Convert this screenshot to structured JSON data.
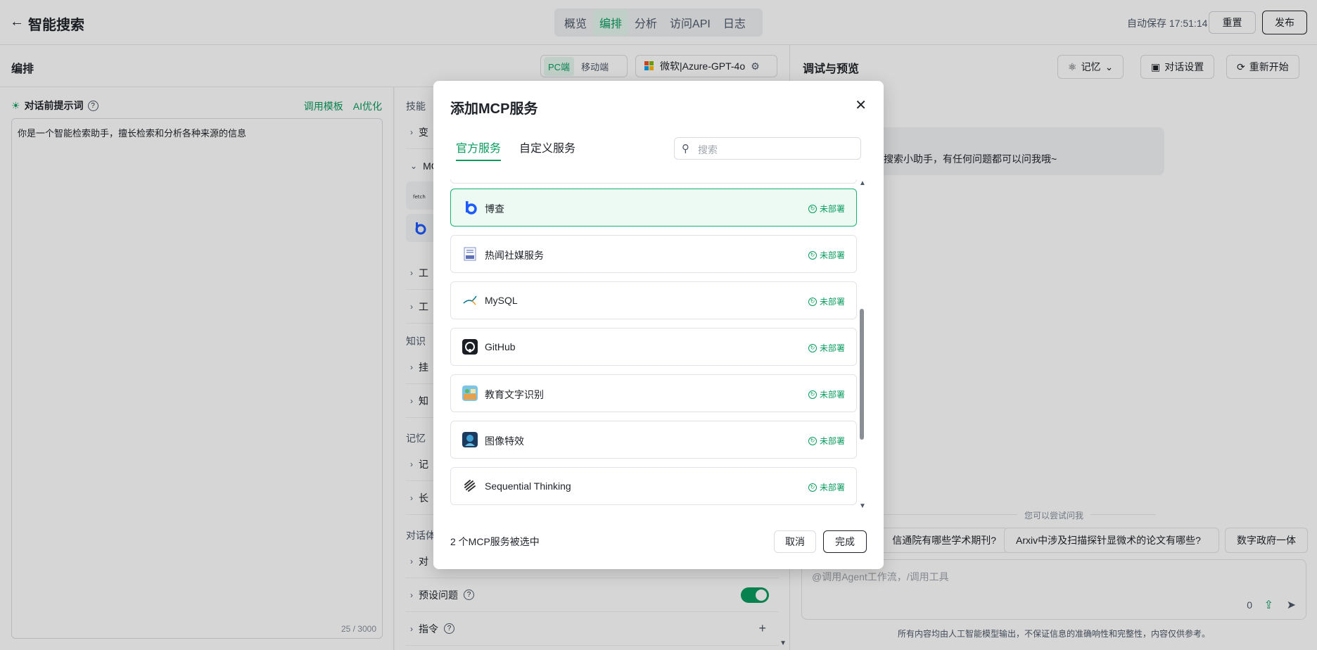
{
  "header": {
    "back_icon": "arrow-left-icon",
    "title": "智能搜索",
    "tabs": [
      {
        "label": "概览",
        "active": false
      },
      {
        "label": "编排",
        "active": true
      },
      {
        "label": "分析",
        "active": false
      },
      {
        "label": "访问API",
        "active": false
      },
      {
        "label": "日志",
        "active": false
      }
    ],
    "autosave": "自动保存 17:51:14",
    "reset_label": "重置",
    "publish_label": "发布"
  },
  "edit": {
    "title": "编排",
    "device_pc": "PC端",
    "device_mobile": "移动端",
    "model": "微软|Azure-GPT-4o"
  },
  "prompt": {
    "title": "对话前提示词",
    "template_link": "调用模板",
    "ai_link": "AI优化",
    "content": "你是一个智能检索助手，擅长检索和分析各种来源的信息",
    "count": "25 / 3000"
  },
  "config": {
    "section_skills": "技能",
    "row_var": "变",
    "row_mcp": "MC",
    "mcp_card1_label": "",
    "mcp_card2_label": "t",
    "row_tool1": "工",
    "row_tool2": "工",
    "section_knowledge": "知识",
    "row_mount": "挂",
    "row_know": "知",
    "section_memory": "记忆",
    "row_mem1": "记",
    "row_mem2": "长",
    "section_dialog": "对话体",
    "row_dialog": "对",
    "row_preset": "预设问题",
    "row_command": "指令",
    "preset_enabled": true
  },
  "debug": {
    "title": "调试与预览",
    "memory_btn": "记忆",
    "dialog_settings_btn": "对话设置",
    "restart_btn": "重新开始",
    "greeting": "搜索小助手，有任何问题都可以问我哦~",
    "suggest_label": "您可以尝试问我",
    "chips": [
      "信通院有哪些学术期刊?",
      "Arxiv中涉及扫描探针显微术的论文有哪些?",
      "数字政府一体"
    ],
    "input_placeholder": "@调用Agent工作流，/调用工具",
    "input_count": "0",
    "disclaimer": "所有内容均由人工智能模型输出，不保证信息的准确响性和完整性，内容仅供参考。"
  },
  "modal": {
    "title": "添加MCP服务",
    "tabs": [
      {
        "label": "官方服务",
        "active": true
      },
      {
        "label": "自定义服务",
        "active": false
      }
    ],
    "search_placeholder": "搜索",
    "items": [
      {
        "name": "博查",
        "status": "未部署",
        "selected": true,
        "logo": "bocha-logo-icon"
      },
      {
        "name": "热闻社媒服务",
        "status": "未部署",
        "selected": false,
        "logo": "news-logo-icon"
      },
      {
        "name": "MySQL",
        "status": "未部署",
        "selected": false,
        "logo": "mysql-logo-icon"
      },
      {
        "name": "GitHub",
        "status": "未部署",
        "selected": false,
        "logo": "github-logo-icon"
      },
      {
        "name": "教育文字识别",
        "status": "未部署",
        "selected": false,
        "logo": "edu-ocr-logo-icon"
      },
      {
        "name": "图像特效",
        "status": "未部署",
        "selected": false,
        "logo": "image-effect-logo-icon"
      },
      {
        "name": "Sequential Thinking",
        "status": "未部署",
        "selected": false,
        "logo": "sequential-thinking-logo-icon"
      }
    ],
    "selected_summary": "2 个MCP服务被选中",
    "cancel_label": "取消",
    "done_label": "完成"
  },
  "colors": {
    "accent": "#0a9b5f",
    "selected_bg": "#ecfaf3",
    "text": "#1f2329"
  }
}
